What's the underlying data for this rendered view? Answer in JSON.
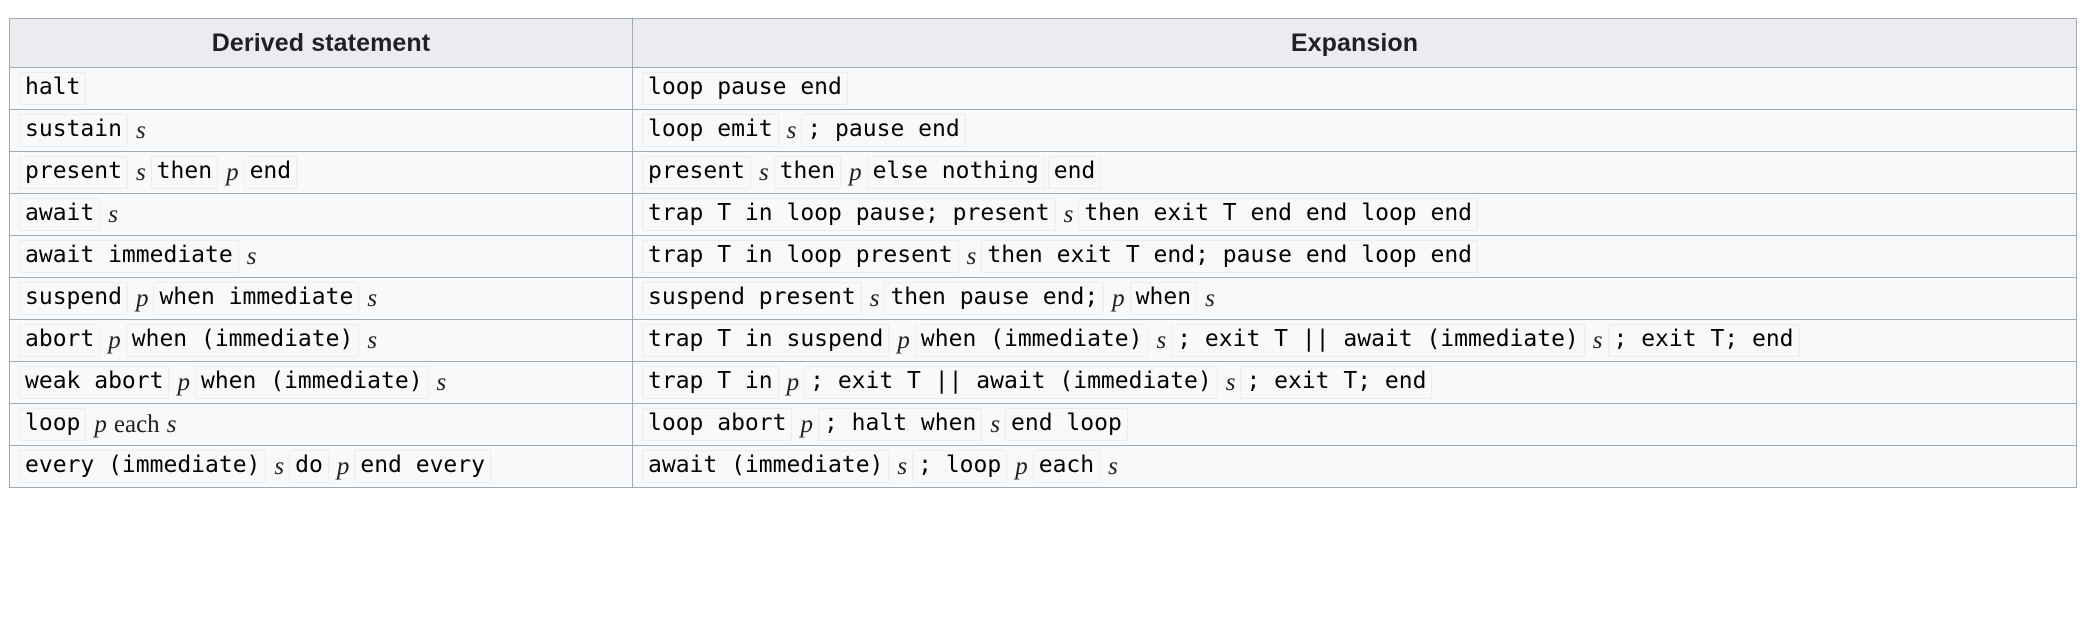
{
  "table": {
    "headers": [
      "Derived statement",
      "Expansion"
    ],
    "colors": {
      "header_background": "#eaecf0",
      "cell_background": "#f8f9fa",
      "border": "#a2a9b1",
      "code_border": "#eaecf0",
      "text": "#202122"
    },
    "rows": [
      {
        "derived": [
          {
            "kind": "code",
            "text": "halt"
          }
        ],
        "expansion": [
          {
            "kind": "code",
            "text": "loop pause end"
          }
        ]
      },
      {
        "derived": [
          {
            "kind": "code",
            "text": "sustain"
          },
          {
            "kind": "var",
            "text": "s"
          }
        ],
        "expansion": [
          {
            "kind": "code",
            "text": "loop emit"
          },
          {
            "kind": "var",
            "text": "s"
          },
          {
            "kind": "code",
            "text": "; pause end"
          }
        ]
      },
      {
        "derived": [
          {
            "kind": "code",
            "text": "present"
          },
          {
            "kind": "var",
            "text": "s"
          },
          {
            "kind": "code",
            "text": "then"
          },
          {
            "kind": "var",
            "text": "p"
          },
          {
            "kind": "code",
            "text": "end"
          }
        ],
        "expansion": [
          {
            "kind": "code",
            "text": "present"
          },
          {
            "kind": "var",
            "text": "s"
          },
          {
            "kind": "code",
            "text": "then"
          },
          {
            "kind": "var",
            "text": "p"
          },
          {
            "kind": "code",
            "text": "else nothing"
          },
          {
            "kind": "code",
            "text": "end"
          }
        ]
      },
      {
        "derived": [
          {
            "kind": "code",
            "text": "await"
          },
          {
            "kind": "var",
            "text": "s"
          }
        ],
        "expansion": [
          {
            "kind": "code",
            "text": "trap T in loop pause; present"
          },
          {
            "kind": "var",
            "text": "s"
          },
          {
            "kind": "code",
            "text": "then exit T end end loop end"
          }
        ]
      },
      {
        "derived": [
          {
            "kind": "code",
            "text": "await immediate"
          },
          {
            "kind": "var",
            "text": "s"
          }
        ],
        "expansion": [
          {
            "kind": "code",
            "text": "trap T in loop present"
          },
          {
            "kind": "var",
            "text": "s"
          },
          {
            "kind": "code",
            "text": "then exit T end; pause end loop end"
          }
        ]
      },
      {
        "derived": [
          {
            "kind": "code",
            "text": "suspend"
          },
          {
            "kind": "var",
            "text": "p"
          },
          {
            "kind": "code",
            "text": "when immediate"
          },
          {
            "kind": "var",
            "text": "s"
          }
        ],
        "expansion": [
          {
            "kind": "code",
            "text": "suspend present"
          },
          {
            "kind": "var",
            "text": "s"
          },
          {
            "kind": "code",
            "text": "then pause end;"
          },
          {
            "kind": "var",
            "text": "p"
          },
          {
            "kind": "code",
            "text": "when"
          },
          {
            "kind": "var",
            "text": "s"
          }
        ]
      },
      {
        "derived": [
          {
            "kind": "code",
            "text": "abort"
          },
          {
            "kind": "var",
            "text": "p"
          },
          {
            "kind": "code",
            "text": "when (immediate)"
          },
          {
            "kind": "var",
            "text": "s"
          }
        ],
        "expansion": [
          {
            "kind": "code",
            "text": "trap T in suspend"
          },
          {
            "kind": "var",
            "text": "p"
          },
          {
            "kind": "code",
            "text": "when (immediate)"
          },
          {
            "kind": "var",
            "text": "s"
          },
          {
            "kind": "code",
            "text": "; exit T || await (immediate)"
          },
          {
            "kind": "var",
            "text": "s"
          },
          {
            "kind": "code",
            "text": "; exit T; end"
          }
        ]
      },
      {
        "derived": [
          {
            "kind": "code",
            "text": "weak abort"
          },
          {
            "kind": "var",
            "text": "p"
          },
          {
            "kind": "code",
            "text": "when (immediate)"
          },
          {
            "kind": "var",
            "text": "s"
          }
        ],
        "expansion": [
          {
            "kind": "code",
            "text": "trap T in"
          },
          {
            "kind": "var",
            "text": "p"
          },
          {
            "kind": "code",
            "text": "; exit T || await (immediate)"
          },
          {
            "kind": "var",
            "text": "s"
          },
          {
            "kind": "code",
            "text": "; exit T; end"
          }
        ]
      },
      {
        "derived": [
          {
            "kind": "code",
            "text": "loop"
          },
          {
            "kind": "var",
            "text": "p"
          },
          {
            "kind": "word",
            "text": "each"
          },
          {
            "kind": "var",
            "text": "s"
          }
        ],
        "expansion": [
          {
            "kind": "code",
            "text": "loop abort"
          },
          {
            "kind": "var",
            "text": "p"
          },
          {
            "kind": "code",
            "text": "; halt when"
          },
          {
            "kind": "var",
            "text": "s"
          },
          {
            "kind": "code",
            "text": "end loop"
          }
        ]
      },
      {
        "derived": [
          {
            "kind": "code",
            "text": "every (immediate)"
          },
          {
            "kind": "var",
            "text": "s"
          },
          {
            "kind": "code",
            "text": "do"
          },
          {
            "kind": "var",
            "text": "p"
          },
          {
            "kind": "code",
            "text": "end every"
          }
        ],
        "expansion": [
          {
            "kind": "code",
            "text": "await (immediate)"
          },
          {
            "kind": "var",
            "text": "s"
          },
          {
            "kind": "code",
            "text": "; loop"
          },
          {
            "kind": "var",
            "text": "p"
          },
          {
            "kind": "code",
            "text": "each"
          },
          {
            "kind": "var",
            "text": "s"
          }
        ]
      }
    ]
  }
}
